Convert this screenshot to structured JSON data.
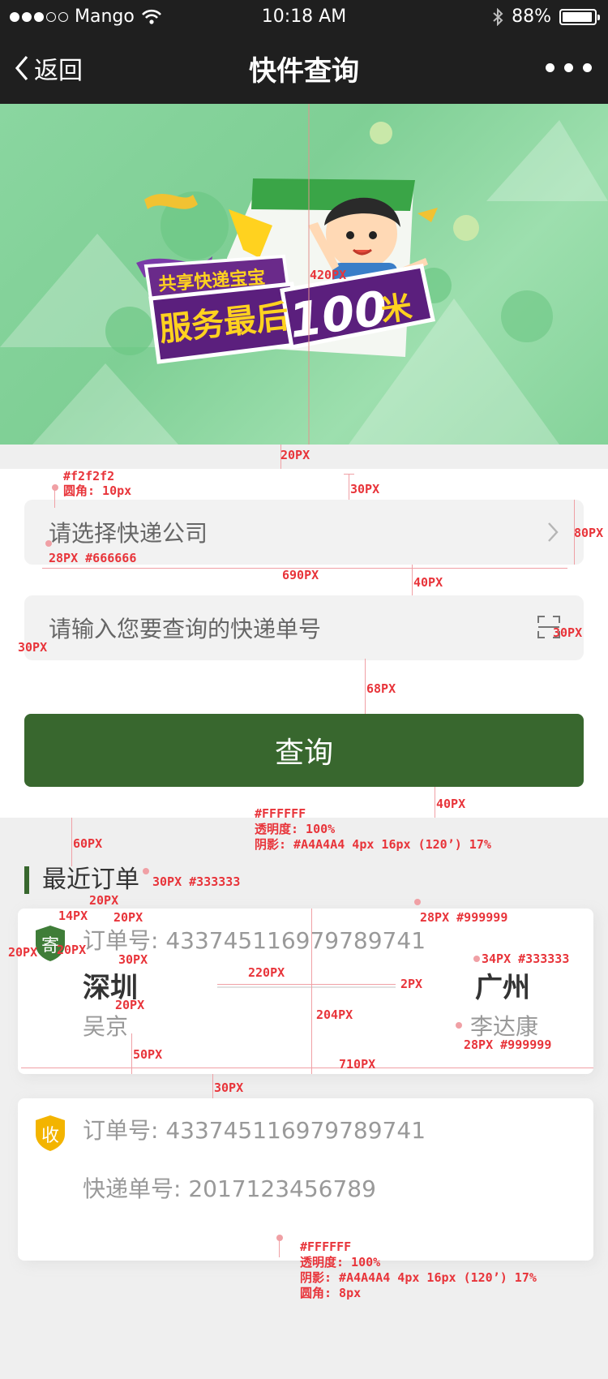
{
  "status_bar": {
    "carrier": "Mango",
    "time": "10:18 AM",
    "battery": "88%",
    "battery_level": 0.88
  },
  "nav": {
    "back_label": "返回",
    "title": "快件查询"
  },
  "banner": {
    "line1": "共享快递宝宝",
    "line2": "服务最后",
    "number": "100",
    "unit": "米"
  },
  "form": {
    "company_placeholder": "请选择快递公司",
    "tracking_placeholder": "请输入您要查询的快递单号",
    "query_button": "查询"
  },
  "recent": {
    "title": "最近订单",
    "orders": [
      {
        "badge": "寄",
        "order_label": "订单号:",
        "order_no": "433745116979789741",
        "from_city": "深圳",
        "from_name": "吴京",
        "to_city": "广州",
        "to_name": "李达康"
      },
      {
        "badge": "收",
        "order_label": "订单号:",
        "order_no": "433745116979789741",
        "tracking_label": "快递单号:",
        "tracking_no": "2017123456789"
      }
    ]
  },
  "annotations": {
    "banner_h": "420PX",
    "gap20": "20PX",
    "field_spec1": "#f2f2f2",
    "field_spec2": "圆角: 10px",
    "pad30": "30PX",
    "field_h": "80PX",
    "text_spec": "28PX #666666",
    "width690": "690PX",
    "gap40": "40PX",
    "side30": "30PX",
    "icon30": "30PX",
    "gap68": "68PX",
    "card_spec": "#FFFFFF\n透明度: 100%\n阴影: #A4A4A4 4px 16px (120’) 17%",
    "gap40b": "40PX",
    "gap60": "60PX",
    "title_spec": "30PX #333333",
    "gap20a": "20PX",
    "badge14": "14PX",
    "badge20a": "20PX",
    "badge20b": "20PX",
    "badge20c": "20PX",
    "order_spec": "28PX #999999",
    "city30": "30PX",
    "line220": "220PX",
    "line2": "2PX",
    "city_spec": "34PX #333333",
    "name20": "20PX",
    "height204": "204PX",
    "bottom50": "50PX",
    "width710": "710PX",
    "name_spec": "28PX #999999",
    "gap30": "30PX",
    "card2_spec": "#FFFFFF\n透明度: 100%\n阴影: #A4A4A4 4px 16px (120’) 17%\n圆角: 8px"
  },
  "colors": {
    "nav_bg": "#1f1f1f",
    "primary": "#38672e",
    "field_bg": "#f2f2f2",
    "page_bg": "#efefef",
    "send_badge": "#3f7d38",
    "receive_badge": "#f3b400"
  }
}
